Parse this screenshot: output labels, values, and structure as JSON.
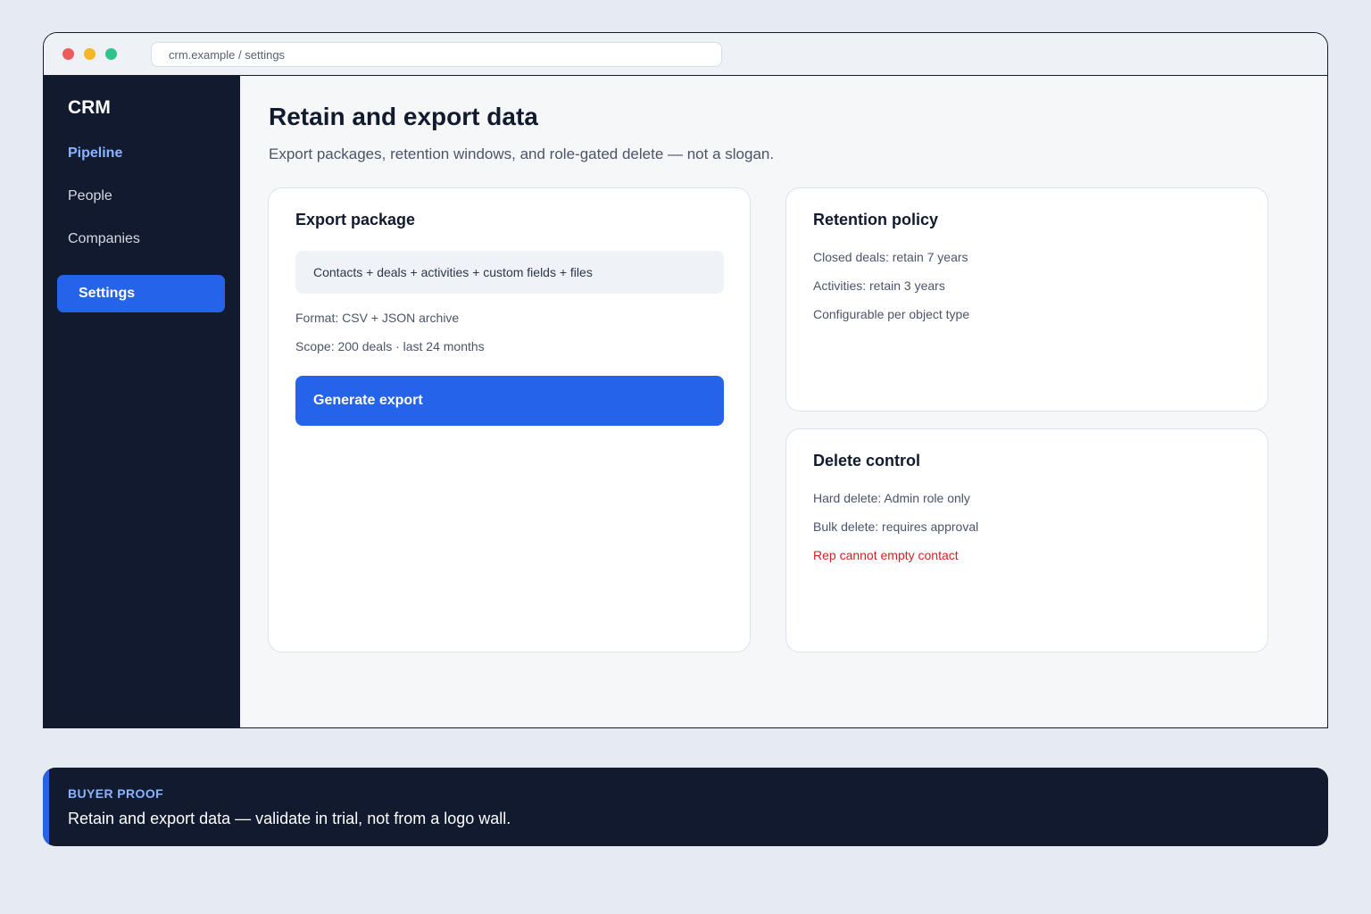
{
  "browser": {
    "url": "crm.example / settings"
  },
  "sidebar": {
    "brand": "CRM",
    "items": [
      {
        "label": "Pipeline"
      },
      {
        "label": "People"
      },
      {
        "label": "Companies"
      },
      {
        "label": "Settings"
      }
    ]
  },
  "main": {
    "title": "Retain and export data",
    "subtitle": "Export packages, retention windows, and role-gated delete — not a slogan."
  },
  "export_card": {
    "title": "Export package",
    "package": "Contacts + deals + activities + custom fields + files",
    "format": "Format: CSV + JSON archive",
    "scope": "Scope: 200 deals · last 24 months",
    "button": "Generate export"
  },
  "retention_card": {
    "title": "Retention policy",
    "lines": [
      "Closed deals: retain 7 years",
      "Activities: retain 3 years",
      "Configurable per object type"
    ]
  },
  "delete_card": {
    "title": "Delete control",
    "lines": [
      "Hard delete: Admin role only",
      "Bulk delete: requires approval",
      "Rep cannot empty contact"
    ]
  },
  "proof": {
    "label": "BUYER PROOF",
    "text": "Retain and export data — validate in trial, not from a logo wall."
  },
  "colors": {
    "accent": "#2563eb",
    "sidebar_bg": "#111a2e",
    "warning": "#d32222"
  }
}
